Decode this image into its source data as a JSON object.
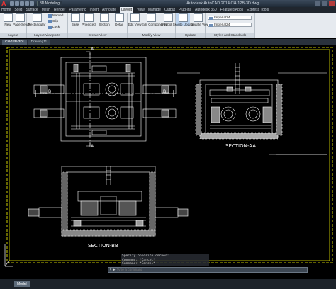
{
  "titlebar": {
    "workspace": "3D Modeling",
    "title": "Autodesk AutoCAD 2014   CH-12B-3D.dwg"
  },
  "ribbon_tabs": [
    "Home",
    "Solid",
    "Surface",
    "Mesh",
    "Render",
    "Parametric",
    "Insert",
    "Annotate",
    "Layout",
    "View",
    "Manage",
    "Output",
    "Plug-ins",
    "Autodesk 360",
    "Featured Apps",
    "Express Tools"
  ],
  "active_ribbon_tab": "Layout",
  "ribbon": {
    "layout_group": {
      "label": "Layout",
      "new": "New",
      "page_setup": "Page Setup"
    },
    "viewports_group": {
      "label": "Layout Viewports",
      "rectangular": "Rectangular",
      "named": "Named",
      "clip": "Clip",
      "lock": "Lock"
    },
    "create_view_group": {
      "label": "Create View",
      "base": "Base",
      "projected": "Projected",
      "section": "Section",
      "detail": "Detail"
    },
    "modify_view_group": {
      "label": "Modify View",
      "edit_view": "Edit View",
      "edit_components": "Edit Components",
      "symbol_sketch": "Symbol Sketch"
    },
    "update_group": {
      "label": "Update",
      "auto_update": "Auto Update",
      "update_view": "Update View"
    },
    "styles_group": {
      "label": "Styles and Standards",
      "style1": "Imperial24",
      "style2": "Imperial24"
    }
  },
  "file_tabs": [
    "CH-12B-3D*",
    "Drawing1*"
  ],
  "drawing": {
    "section_aa": "SECTION-AA",
    "section_bb": "SECTION-BB",
    "cut_a": "A",
    "cut_b": "B"
  },
  "command": {
    "history": [
      "Specify opposite corner:",
      "Command: *Cancel*",
      "Command: *Cancel*"
    ],
    "placeholder": "Type a command"
  },
  "layout_tabs": [
    "Model"
  ],
  "colors": {
    "border": "#ffff00",
    "linework": "#ffffff",
    "background": "#000000"
  }
}
